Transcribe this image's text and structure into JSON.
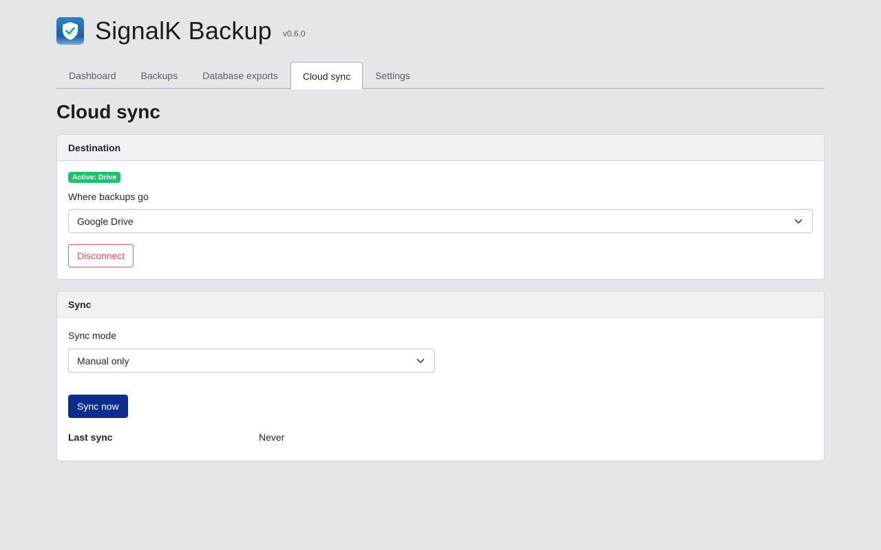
{
  "app": {
    "title": "SignalK Backup",
    "version": "v0.6.0",
    "logo_icon": "shield-check-icon"
  },
  "tabs": [
    {
      "label": "Dashboard",
      "active": false
    },
    {
      "label": "Backups",
      "active": false
    },
    {
      "label": "Database exports",
      "active": false
    },
    {
      "label": "Cloud sync",
      "active": true
    },
    {
      "label": "Settings",
      "active": false
    }
  ],
  "page": {
    "title": "Cloud sync"
  },
  "destination": {
    "header": "Destination",
    "badge": "Active: Drive",
    "field_label": "Where backups go",
    "selected": "Google Drive",
    "disconnect_label": "Disconnect"
  },
  "sync": {
    "header": "Sync",
    "mode_label": "Sync mode",
    "mode_selected": "Manual only",
    "sync_now_label": "Sync now",
    "last_sync_label": "Last sync",
    "last_sync_value": "Never"
  },
  "colors": {
    "primary": "#0a2d8f",
    "danger": "#d9534f",
    "success_badge": "#1fc06d",
    "background": "#e5e6e8"
  }
}
